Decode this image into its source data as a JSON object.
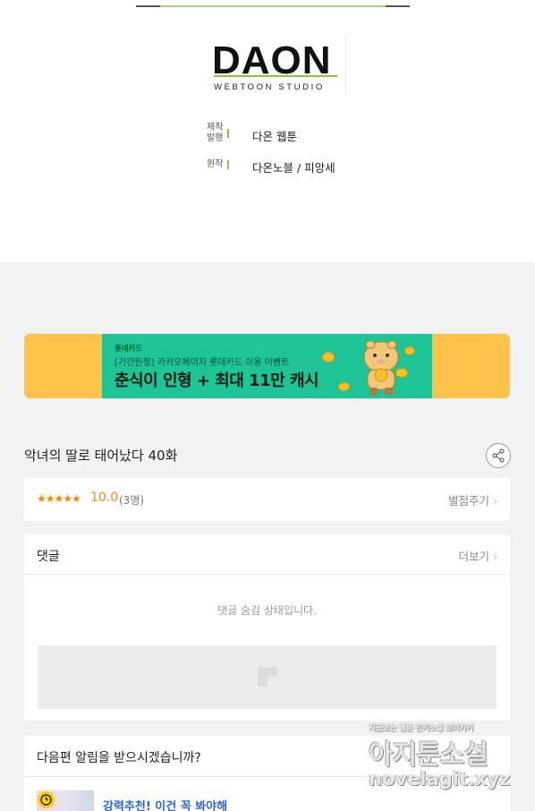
{
  "credits_header": {
    "logo": {
      "main": "DAON",
      "sub": "WEBTOON STUDIO"
    },
    "production_label": "제작\n발행",
    "production_value": "다온 웹툰",
    "original_label": "원작",
    "original_value": "다온노블 / 피앙세"
  },
  "banner": {
    "brand": "롯데카드",
    "subtitle": "[기간한정] 카카오페이지 롯데카드 이용 이벤트",
    "title": "춘식이 인형 + 최대 11만 캐시",
    "colors": {
      "outer": "#ffc24a",
      "inner": "#1fc496"
    }
  },
  "episode": {
    "title": "악녀의 딸로 태어났다 40화",
    "share_icon": "share-icon"
  },
  "rating": {
    "stars": "★★★★★",
    "score": "10.0",
    "count": "(3명)",
    "rate_link": "별점주기"
  },
  "comments": {
    "header": "댓글",
    "more": "더보기",
    "hidden_message": "댓글 숨김 상태입니다."
  },
  "notify": {
    "question": "다음편 알림을 받으시겠습니까?",
    "recommend_title": "강력추천! 이건 꼭 봐야해"
  },
  "watermark": {
    "tagline": "지금보는 웹툰 인기소설 보러가기",
    "name": "아지툰소설",
    "url": "novelagit.xyz"
  }
}
